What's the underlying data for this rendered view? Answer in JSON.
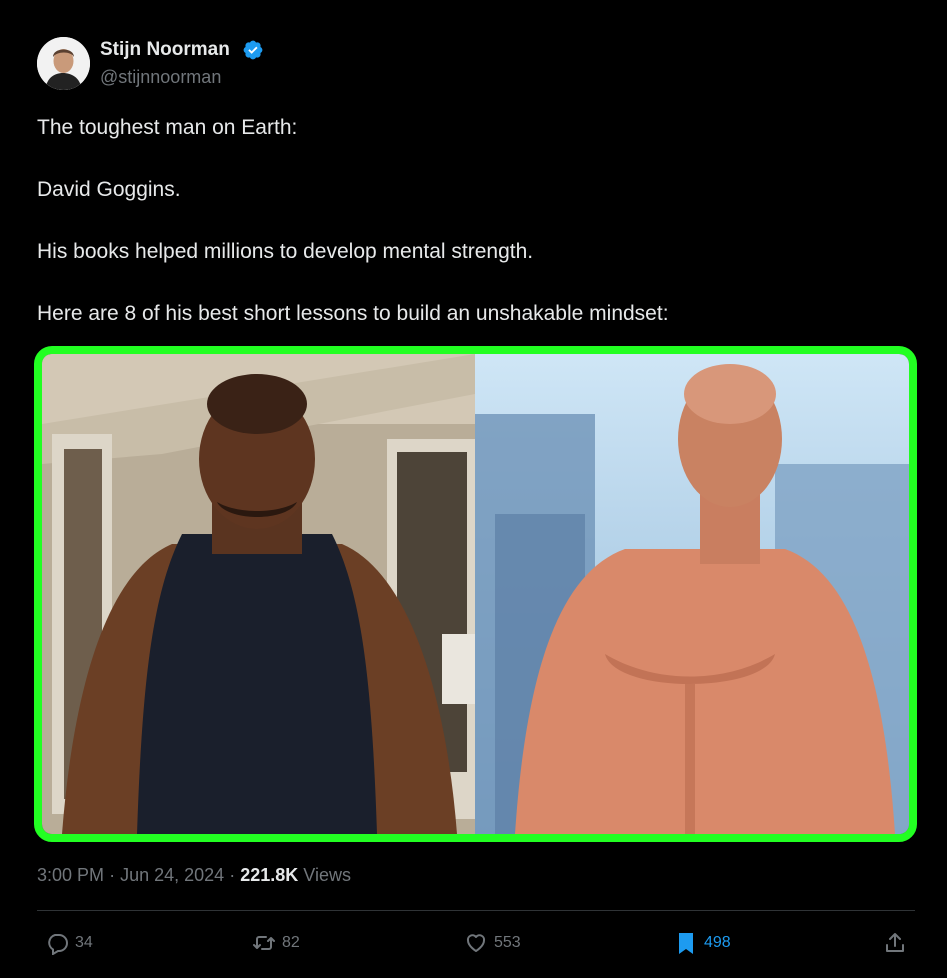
{
  "author": {
    "name": "Stijn Noorman",
    "handle": "@stijnnoorman",
    "verified": true,
    "verified_color": "#1d9bf0"
  },
  "tweet": {
    "lines": [
      "The toughest man on Earth:",
      "David Goggins.",
      "His books helped millions to develop mental strength.",
      "Here are 8 of his best short lessons to build an unshakable mindset:"
    ]
  },
  "media": {
    "frame_color": "#22ff22",
    "images": [
      {
        "icon": "photo-before"
      },
      {
        "icon": "photo-after"
      }
    ]
  },
  "meta": {
    "time": "3:00 PM",
    "separator": "·",
    "date": "Jun 24, 2024",
    "views_count": "221.8K",
    "views_label": "Views"
  },
  "actions": {
    "reply": {
      "count": "34",
      "icon": "reply-icon"
    },
    "retweet": {
      "count": "82",
      "icon": "retweet-icon"
    },
    "like": {
      "count": "553",
      "icon": "heart-icon"
    },
    "bookmark": {
      "count": "498",
      "icon": "bookmark-icon",
      "active": true,
      "color": "#1d9bf0"
    },
    "share": {
      "icon": "share-icon"
    }
  }
}
